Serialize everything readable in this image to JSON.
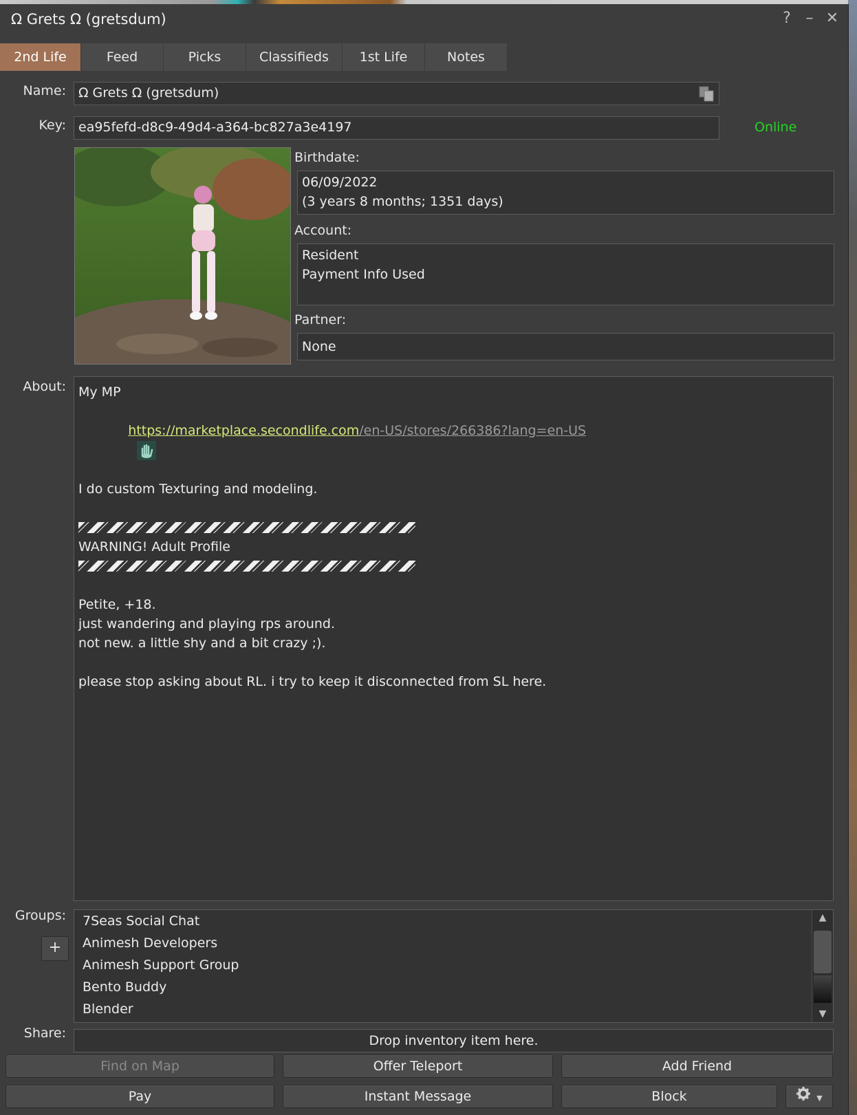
{
  "window": {
    "title": "Ω Grets Ω (gretsdum)",
    "help_icon": "?",
    "minimize_icon": "–",
    "close_icon": "✕"
  },
  "tabs": [
    {
      "label": "2nd Life",
      "active": true
    },
    {
      "label": "Feed"
    },
    {
      "label": "Picks"
    },
    {
      "label": "Classifieds"
    },
    {
      "label": "1st Life"
    },
    {
      "label": "Notes"
    }
  ],
  "profile": {
    "name_label": "Name:",
    "name_value": "Ω Grets Ω (gretsdum)",
    "key_label": "Key:",
    "key_value": "ea95fefd-d8c9-49d4-a364-bc827a3e4197",
    "status": "Online",
    "status_color": "#25d425",
    "birthdate_label": "Birthdate:",
    "birthdate_line1": "06/09/2022",
    "birthdate_line2": "(3 years 8 months; 1351 days)",
    "account_label": "Account:",
    "account_line1": "Resident",
    "account_line2": "Payment Info Used",
    "partner_label": "Partner:",
    "partner_value": "None"
  },
  "about": {
    "label": "About:",
    "line1": "My MP",
    "link_domain": "https://marketplace.secondlife.com",
    "link_path": "/en-US/stores/266386?lang=en-US",
    "line3": "I do custom Texturing and modeling.",
    "warning": "WARNING! Adult Profile",
    "line5": "Petite, +18.",
    "line6": "just wandering and playing rps around.",
    "line7": "not new. a little shy and a bit crazy ;).",
    "line8": "please stop asking about RL. i try to keep it disconnected from SL here."
  },
  "groups": {
    "label": "Groups:",
    "add_label": "+",
    "items": [
      "7Seas Social Chat",
      "Animesh Developers",
      "Animesh Support Group",
      "Bento Buddy",
      "Blender"
    ]
  },
  "share": {
    "label": "Share:",
    "drop_text": "Drop inventory item here."
  },
  "buttons": {
    "find_on_map": "Find on Map",
    "offer_teleport": "Offer Teleport",
    "add_friend": "Add Friend",
    "pay": "Pay",
    "instant_message": "Instant Message",
    "block": "Block"
  }
}
